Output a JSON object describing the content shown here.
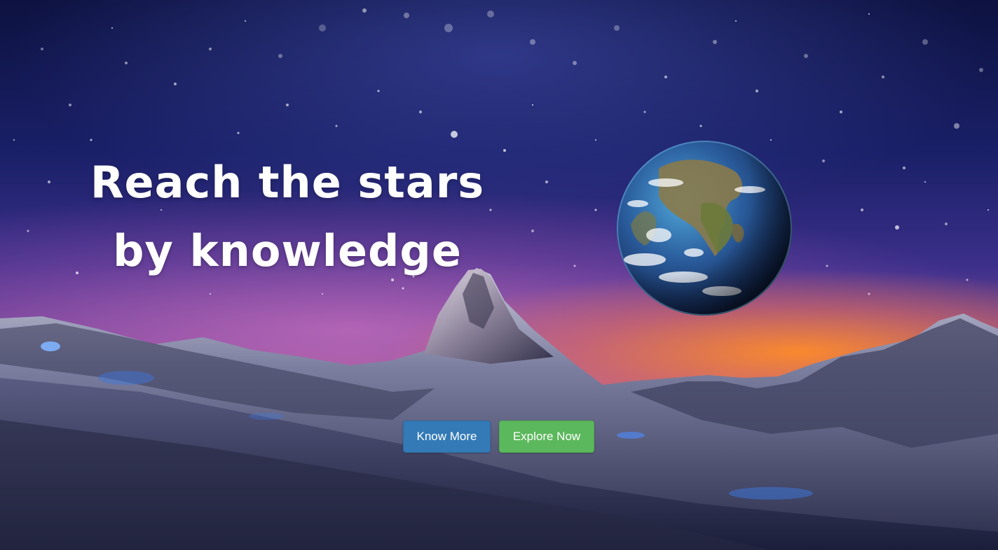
{
  "hero": {
    "headline_line1": "Reach the stars",
    "headline_line2": "by knowledge"
  },
  "buttons": {
    "know_more": "Know More",
    "explore_now": "Explore Now"
  },
  "colors": {
    "primary_button": "#337ab7",
    "success_button": "#5cb85c",
    "headline_text": "#ffffff"
  },
  "icons": {
    "planet": "earth-globe"
  }
}
